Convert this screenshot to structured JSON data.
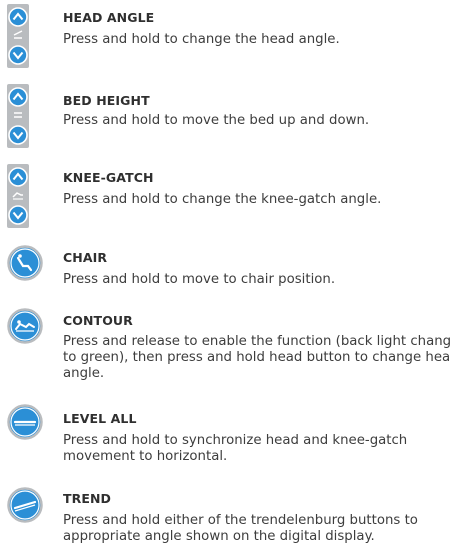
{
  "items": [
    {
      "title": "HEAD ANGLE",
      "desc": "Press and hold to change the head angle.",
      "icon": "head-angle-up-down-icon"
    },
    {
      "title": "BED HEIGHT",
      "desc": "Press and hold to move the bed up and down.",
      "icon": "bed-height-up-down-icon"
    },
    {
      "title": "KNEE-GATCH",
      "desc": "Press and hold to change the knee-gatch angle.",
      "icon": "knee-gatch-up-down-icon"
    },
    {
      "title": "CHAIR",
      "desc": "Press and hold to move to chair position.",
      "icon": "chair-position-icon"
    },
    {
      "title": "CONTOUR",
      "desc": "Press and release to enable the function (back light change to green), then press and hold head button to change head angle.",
      "icon": "contour-icon"
    },
    {
      "title": "LEVEL ALL",
      "desc": "Press and hold to synchronize head and knee-gatch movement to horizontal.",
      "icon": "level-all-icon"
    },
    {
      "title": "TREND",
      "desc": "Press and hold either of the trendelenburg buttons to appropriate angle shown on the digital display.",
      "icon": "trend-icon"
    }
  ],
  "colors": {
    "accent": "#2b8fd6",
    "panel": "#b9bcbf",
    "text": "#3d3d3d"
  }
}
